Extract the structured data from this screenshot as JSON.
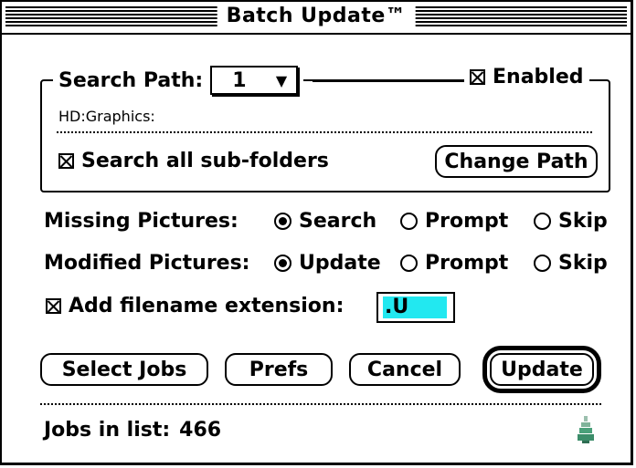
{
  "window": {
    "title": "Batch Update™"
  },
  "search_group": {
    "label": "Search Path:",
    "path_popup_value": "1",
    "path_popup_arrow": "▼",
    "enabled_label": "Enabled",
    "enabled_checked": true,
    "path": "HD:Graphics:",
    "subfolders_label": "Search all sub-folders",
    "subfolders_checked": true,
    "change_path_button": "Change Path"
  },
  "missing_pictures": {
    "label": "Missing Pictures:",
    "options": [
      "Search",
      "Prompt",
      "Skip"
    ],
    "selected": "Search"
  },
  "modified_pictures": {
    "label": "Modified Pictures:",
    "options": [
      "Update",
      "Prompt",
      "Skip"
    ],
    "selected": "Update"
  },
  "extension": {
    "label": "Add filename extension:",
    "checked": true,
    "value": ".U"
  },
  "buttons": {
    "select_jobs": "Select Jobs",
    "prefs": "Prefs",
    "cancel": "Cancel",
    "update": "Update"
  },
  "status": {
    "jobs_label": "Jobs in list:",
    "jobs_count": "466"
  },
  "colors": {
    "selection": "#22e8f0",
    "logo": "#4aa07a"
  }
}
